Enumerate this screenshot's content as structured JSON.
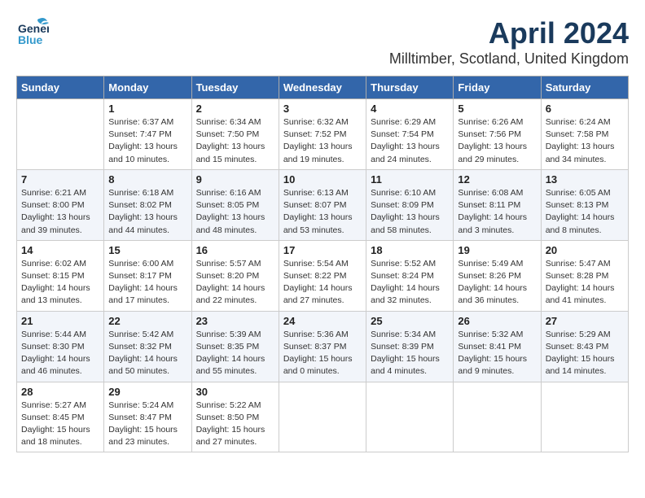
{
  "header": {
    "logo_line1": "General",
    "logo_line2": "Blue",
    "month": "April 2024",
    "location": "Milltimber, Scotland, United Kingdom"
  },
  "weekdays": [
    "Sunday",
    "Monday",
    "Tuesday",
    "Wednesday",
    "Thursday",
    "Friday",
    "Saturday"
  ],
  "weeks": [
    [
      {
        "day": "",
        "info": ""
      },
      {
        "day": "1",
        "info": "Sunrise: 6:37 AM\nSunset: 7:47 PM\nDaylight: 13 hours\nand 10 minutes."
      },
      {
        "day": "2",
        "info": "Sunrise: 6:34 AM\nSunset: 7:50 PM\nDaylight: 13 hours\nand 15 minutes."
      },
      {
        "day": "3",
        "info": "Sunrise: 6:32 AM\nSunset: 7:52 PM\nDaylight: 13 hours\nand 19 minutes."
      },
      {
        "day": "4",
        "info": "Sunrise: 6:29 AM\nSunset: 7:54 PM\nDaylight: 13 hours\nand 24 minutes."
      },
      {
        "day": "5",
        "info": "Sunrise: 6:26 AM\nSunset: 7:56 PM\nDaylight: 13 hours\nand 29 minutes."
      },
      {
        "day": "6",
        "info": "Sunrise: 6:24 AM\nSunset: 7:58 PM\nDaylight: 13 hours\nand 34 minutes."
      }
    ],
    [
      {
        "day": "7",
        "info": "Sunrise: 6:21 AM\nSunset: 8:00 PM\nDaylight: 13 hours\nand 39 minutes."
      },
      {
        "day": "8",
        "info": "Sunrise: 6:18 AM\nSunset: 8:02 PM\nDaylight: 13 hours\nand 44 minutes."
      },
      {
        "day": "9",
        "info": "Sunrise: 6:16 AM\nSunset: 8:05 PM\nDaylight: 13 hours\nand 48 minutes."
      },
      {
        "day": "10",
        "info": "Sunrise: 6:13 AM\nSunset: 8:07 PM\nDaylight: 13 hours\nand 53 minutes."
      },
      {
        "day": "11",
        "info": "Sunrise: 6:10 AM\nSunset: 8:09 PM\nDaylight: 13 hours\nand 58 minutes."
      },
      {
        "day": "12",
        "info": "Sunrise: 6:08 AM\nSunset: 8:11 PM\nDaylight: 14 hours\nand 3 minutes."
      },
      {
        "day": "13",
        "info": "Sunrise: 6:05 AM\nSunset: 8:13 PM\nDaylight: 14 hours\nand 8 minutes."
      }
    ],
    [
      {
        "day": "14",
        "info": "Sunrise: 6:02 AM\nSunset: 8:15 PM\nDaylight: 14 hours\nand 13 minutes."
      },
      {
        "day": "15",
        "info": "Sunrise: 6:00 AM\nSunset: 8:17 PM\nDaylight: 14 hours\nand 17 minutes."
      },
      {
        "day": "16",
        "info": "Sunrise: 5:57 AM\nSunset: 8:20 PM\nDaylight: 14 hours\nand 22 minutes."
      },
      {
        "day": "17",
        "info": "Sunrise: 5:54 AM\nSunset: 8:22 PM\nDaylight: 14 hours\nand 27 minutes."
      },
      {
        "day": "18",
        "info": "Sunrise: 5:52 AM\nSunset: 8:24 PM\nDaylight: 14 hours\nand 32 minutes."
      },
      {
        "day": "19",
        "info": "Sunrise: 5:49 AM\nSunset: 8:26 PM\nDaylight: 14 hours\nand 36 minutes."
      },
      {
        "day": "20",
        "info": "Sunrise: 5:47 AM\nSunset: 8:28 PM\nDaylight: 14 hours\nand 41 minutes."
      }
    ],
    [
      {
        "day": "21",
        "info": "Sunrise: 5:44 AM\nSunset: 8:30 PM\nDaylight: 14 hours\nand 46 minutes."
      },
      {
        "day": "22",
        "info": "Sunrise: 5:42 AM\nSunset: 8:32 PM\nDaylight: 14 hours\nand 50 minutes."
      },
      {
        "day": "23",
        "info": "Sunrise: 5:39 AM\nSunset: 8:35 PM\nDaylight: 14 hours\nand 55 minutes."
      },
      {
        "day": "24",
        "info": "Sunrise: 5:36 AM\nSunset: 8:37 PM\nDaylight: 15 hours\nand 0 minutes."
      },
      {
        "day": "25",
        "info": "Sunrise: 5:34 AM\nSunset: 8:39 PM\nDaylight: 15 hours\nand 4 minutes."
      },
      {
        "day": "26",
        "info": "Sunrise: 5:32 AM\nSunset: 8:41 PM\nDaylight: 15 hours\nand 9 minutes."
      },
      {
        "day": "27",
        "info": "Sunrise: 5:29 AM\nSunset: 8:43 PM\nDaylight: 15 hours\nand 14 minutes."
      }
    ],
    [
      {
        "day": "28",
        "info": "Sunrise: 5:27 AM\nSunset: 8:45 PM\nDaylight: 15 hours\nand 18 minutes."
      },
      {
        "day": "29",
        "info": "Sunrise: 5:24 AM\nSunset: 8:47 PM\nDaylight: 15 hours\nand 23 minutes."
      },
      {
        "day": "30",
        "info": "Sunrise: 5:22 AM\nSunset: 8:50 PM\nDaylight: 15 hours\nand 27 minutes."
      },
      {
        "day": "",
        "info": ""
      },
      {
        "day": "",
        "info": ""
      },
      {
        "day": "",
        "info": ""
      },
      {
        "day": "",
        "info": ""
      }
    ]
  ]
}
